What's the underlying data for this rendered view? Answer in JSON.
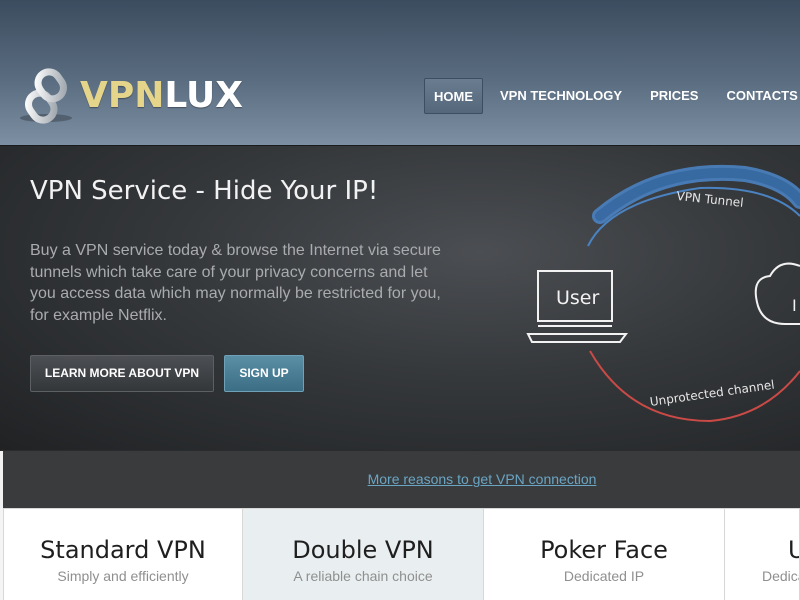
{
  "brand": {
    "logo_part1": "VPN",
    "logo_part2": "LUX",
    "logo_icon": "interlocked-rings-logo"
  },
  "nav": {
    "items": [
      {
        "label": "HOME",
        "active": true
      },
      {
        "label": "VPN TECHNOLOGY",
        "active": false
      },
      {
        "label": "PRICES",
        "active": false
      },
      {
        "label": "CONTACTS",
        "active": false
      }
    ]
  },
  "hero": {
    "title": "VPN Service - Hide Your IP!",
    "text": "Buy a VPN service today & browse the Internet via secure tunnels which take care of your privacy concerns and let you access data which may normally be restricted for you, for example Netflix.",
    "learn_button": "LEARN MORE ABOUT VPN",
    "signup_button": "SIGN UP",
    "diagram": {
      "user_label": "User",
      "tunnel_label": "VPN Tunnel",
      "unprotected_label": "Unprotected channel",
      "cloud_label": "I",
      "tunnel_color": "#4a82c2",
      "unprotected_color": "#c94a46"
    }
  },
  "reasons": {
    "link": "More reasons to get VPN connection"
  },
  "plans": [
    {
      "name": "Standard VPN",
      "subtitle": "Simply and efficiently",
      "featured": false
    },
    {
      "name": "Double VPN",
      "subtitle": "A reliable chain choice",
      "featured": true
    },
    {
      "name": "Poker Face",
      "subtitle": "Dedicated IP",
      "featured": false
    },
    {
      "name": "U",
      "subtitle": "Dedica",
      "featured": false
    }
  ],
  "colors": {
    "accent_gold": "#e4d58a",
    "link_blue": "#6aa5c4",
    "signup_blue": "#3c6e85"
  }
}
